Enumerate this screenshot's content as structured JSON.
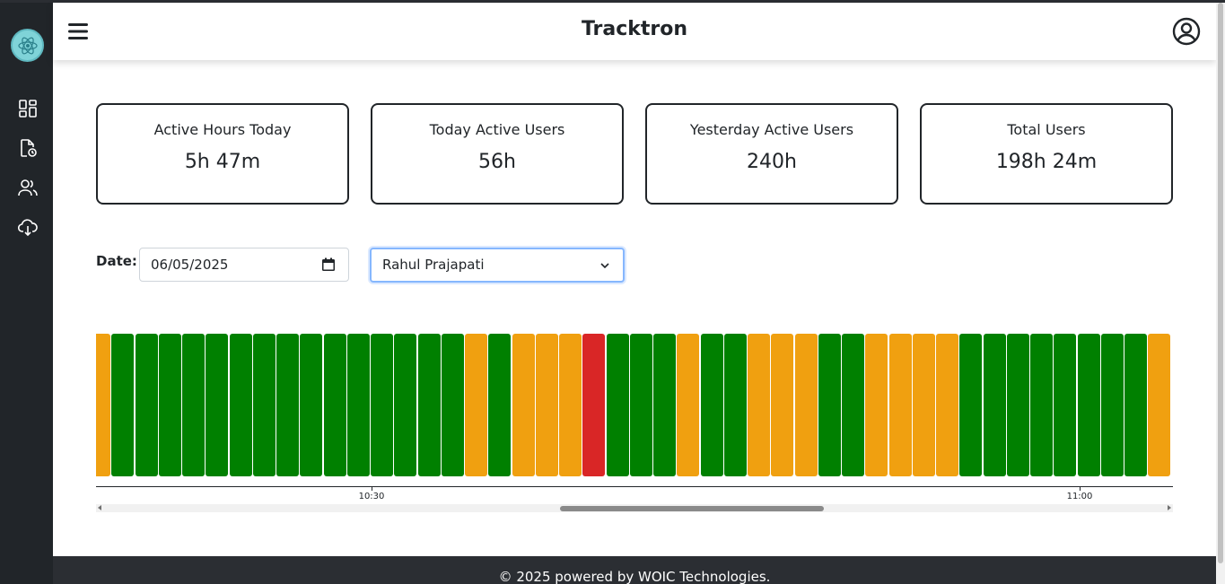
{
  "header": {
    "title": "Tracktron"
  },
  "sidebar": {
    "items": [
      {
        "name": "dashboard"
      },
      {
        "name": "reports"
      },
      {
        "name": "users"
      },
      {
        "name": "download"
      }
    ]
  },
  "stats": [
    {
      "label": "Active Hours Today",
      "value": "5h 47m"
    },
    {
      "label": "Today Active Users",
      "value": "56h"
    },
    {
      "label": "Yesterday Active Users",
      "value": "240h"
    },
    {
      "label": "Total Users",
      "value": "198h 24m"
    }
  ],
  "filters": {
    "date_label": "Date:",
    "date_value": "06/05/2025",
    "user_selected": "Rahul Prajapati"
  },
  "colors": {
    "active": "#008000",
    "idle": "#f0a010",
    "inactive": "#d92626",
    "sidebar": "#212529"
  },
  "chart_data": {
    "type": "bar",
    "segments": [
      "idle",
      "active",
      "active",
      "active",
      "active",
      "active",
      "active",
      "active",
      "active",
      "active",
      "active",
      "active",
      "active",
      "active",
      "active",
      "active",
      "idle",
      "active",
      "idle",
      "idle",
      "idle",
      "inactive",
      "active",
      "active",
      "active",
      "idle",
      "active",
      "active",
      "idle",
      "idle",
      "idle",
      "active",
      "active",
      "idle",
      "idle",
      "idle",
      "idle",
      "active",
      "active",
      "active",
      "active",
      "active",
      "active",
      "active",
      "active",
      "idle"
    ],
    "ticks": [
      "10:30",
      "11:00"
    ]
  },
  "footer": {
    "text": "© 2025 powered by WOIC Technologies."
  }
}
